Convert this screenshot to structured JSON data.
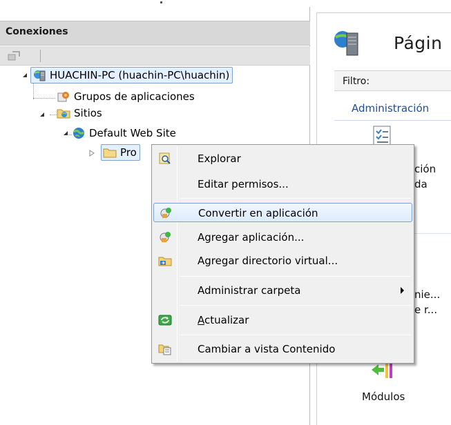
{
  "connections_panel": {
    "title": "Conexiones"
  },
  "tree": {
    "server": "HUACHIN-PC (huachin-PC\\huachin)",
    "app_pools": "Grupos de aplicaciones",
    "sites": "Sitios",
    "default_site": "Default Web Site",
    "folder": "Pro"
  },
  "right_panel": {
    "page_title": "Págin",
    "filter_label": "Filtro:",
    "group_label": "Administración",
    "feature_1_line1": "ción",
    "feature_1_line2": "da",
    "feature_2_line1": "nie...",
    "feature_2_line2": "e r...",
    "modules_label": "Módulos"
  },
  "context_menu": {
    "items": [
      {
        "label": "Explorar",
        "icon": "explore-icon"
      },
      {
        "label": "Editar permisos...",
        "icon": ""
      },
      {
        "label": "Convertir en aplicación",
        "icon": "convert-app-icon"
      },
      {
        "label": "Agregar aplicación...",
        "icon": "add-app-icon"
      },
      {
        "label": "Agregar directorio virtual...",
        "icon": "add-vdir-icon"
      },
      {
        "label": "Administrar carpeta",
        "icon": ""
      },
      {
        "label_prefix": "A",
        "label_rest": "ctualizar",
        "icon": "refresh-icon"
      },
      {
        "label": "Cambiar a vista Contenido",
        "icon": "content-view-icon"
      }
    ]
  },
  "colors": {
    "hover_border": "#7da2ce",
    "link_blue": "#1f4e92",
    "menu_bg": "#f0f0f0"
  }
}
